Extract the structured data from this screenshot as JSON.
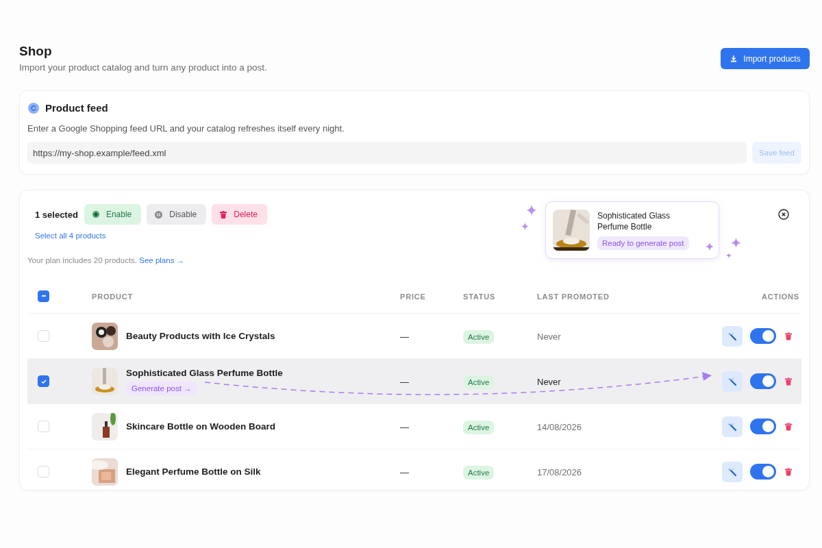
{
  "header": {
    "title": "Shop",
    "subtitle": "Import your product catalog and turn any product into a post.",
    "import_button": "Import products"
  },
  "feed": {
    "title": "Product feed",
    "description": "Enter a Google Shopping feed URL and your catalog refreshes itself every night.",
    "url": "https://my-shop.example/feed.xml",
    "save_button": {
      "label": "Save feed",
      "disabled": true
    }
  },
  "bulk": {
    "count": "1 selected",
    "actions": [
      {
        "label": "Enable",
        "kind": "enable"
      },
      {
        "label": "Disable",
        "kind": "disable"
      },
      {
        "label": "Delete",
        "kind": "delete"
      }
    ],
    "select_all": "Select all 4 products"
  },
  "plan": {
    "text": "Your plan includes 20 products.",
    "link": "See plans →"
  },
  "popup": {
    "title": "Sophisticated Glass Perfume Bottle",
    "badge": "Ready to generate post"
  },
  "table": {
    "header_checkbox": {
      "indeterminate": true
    },
    "columns": [
      "PRODUCT",
      "PRICE",
      "STATUS",
      "LAST PROMOTED",
      "ACTIONS"
    ],
    "rows": [
      {
        "name": "Beauty Products with Ice Crystals",
        "price": "—",
        "status": "Active",
        "last_promoted": "Never",
        "selected": false,
        "enabled": true
      },
      {
        "name": "Sophisticated Glass Perfume Bottle",
        "chip": "Generate post →",
        "price": "—",
        "status": "Active",
        "last_promoted": "Never",
        "selected": true,
        "enabled": true
      },
      {
        "name": "Skincare Bottle on Wooden Board",
        "price": "—",
        "status": "Active",
        "last_promoted": "14/08/2026",
        "selected": false,
        "enabled": true
      },
      {
        "name": "Elegant Perfume Bottle on Silk",
        "price": "—",
        "status": "Active",
        "last_promoted": "17/08/2026",
        "selected": false,
        "enabled": true
      }
    ]
  }
}
